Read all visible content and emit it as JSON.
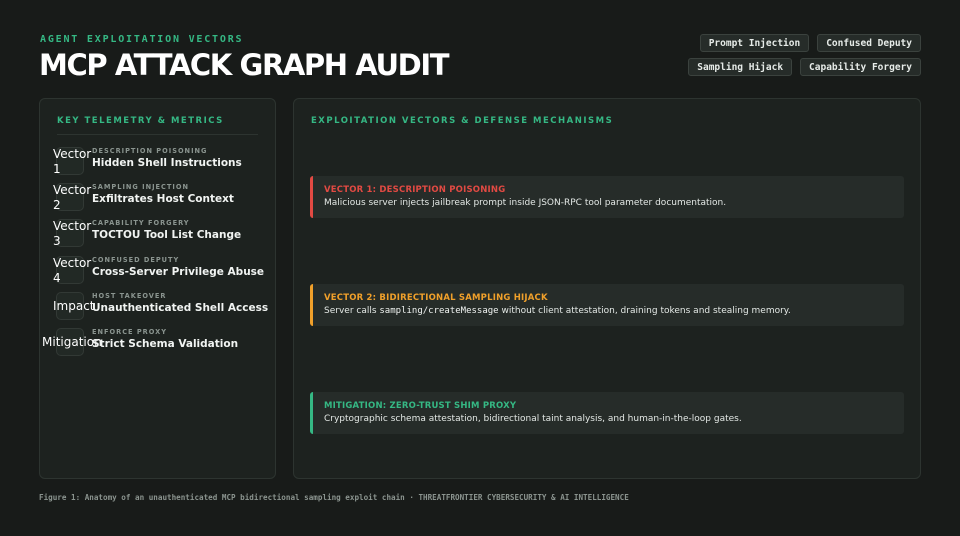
{
  "header": {
    "eyebrow": "AGENT EXPLOITATION VECTORS",
    "title": "MCP ATTACK GRAPH AUDIT",
    "tags": [
      "Prompt Injection",
      "Confused Deputy",
      "Sampling Hijack",
      "Capability Forgery"
    ]
  },
  "telemetry": {
    "heading": "KEY TELEMETRY & METRICS",
    "metrics": [
      {
        "icon_label": "Vector 1",
        "icon": "vector-icon",
        "kicker": "DESCRIPTION POISONING",
        "value": "Hidden Shell Instructions"
      },
      {
        "icon_label": "Vector 2",
        "icon": "vector-icon",
        "kicker": "SAMPLING INJECTION",
        "value": "Exfiltrates Host Context"
      },
      {
        "icon_label": "Vector 3",
        "icon": "vector-icon",
        "kicker": "CAPABILITY FORGERY",
        "value": "TOCTOU Tool List Change"
      },
      {
        "icon_label": "Vector 4",
        "icon": "vector-icon",
        "kicker": "CONFUSED DEPUTY",
        "value": "Cross-Server Privilege Abuse"
      },
      {
        "icon_label": "Impact",
        "icon": "impact-icon",
        "kicker": "HOST TAKEOVER",
        "value": "Unauthenticated Shell Access"
      },
      {
        "icon_label": "Mitigation",
        "icon": "mitigation-icon",
        "kicker": "ENFORCE PROXY",
        "value": "Strict Schema Validation"
      }
    ]
  },
  "vectors": {
    "heading": "EXPLOITATION VECTORS & DEFENSE MECHANISMS",
    "cards": [
      {
        "title": "VECTOR 1: DESCRIPTION POISONING",
        "color": "#e24a43",
        "body_pre": "Malicious server injects jailbreak prompt inside JSON-RPC tool parameter documentation.",
        "code": "",
        "body_post": ""
      },
      {
        "title": "VECTOR 2: BIDIRECTIONAL SAMPLING HIJACK",
        "color": "#f0a02a",
        "body_pre": "Server calls ",
        "code": "sampling/createMessage",
        "body_post": " without client attestation, draining tokens and stealing memory."
      },
      {
        "title": "MITIGATION: ZERO-TRUST SHIM PROXY",
        "color": "#35b884",
        "body_pre": "Cryptographic schema attestation, bidirectional taint analysis, and human-in-the-loop gates.",
        "code": "",
        "body_post": ""
      }
    ]
  },
  "caption": "Figure 1: Anatomy of an unauthenticated MCP bidirectional sampling exploit chain · THREATFRONTIER CYBERSECURITY & AI INTELLIGENCE"
}
